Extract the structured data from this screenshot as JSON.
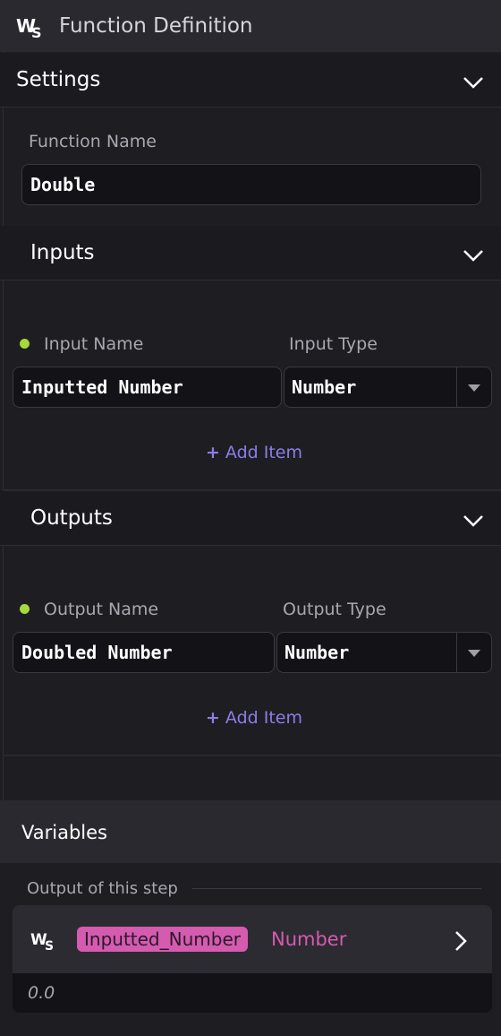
{
  "header": {
    "title": "Function Definition",
    "logo_icon": "ws-logo-icon"
  },
  "settings": {
    "title": "Settings",
    "function_name_label": "Function Name",
    "function_name_value": "Double"
  },
  "inputs": {
    "title": "Inputs",
    "name_label": "Input Name",
    "type_label": "Input Type",
    "name_value": "Inputted Number",
    "type_value": "Number",
    "add_item": "Add Item"
  },
  "outputs": {
    "title": "Outputs",
    "name_label": "Output Name",
    "type_label": "Output Type",
    "name_value": "Doubled Number",
    "type_value": "Number",
    "add_item": "Add Item"
  },
  "variables": {
    "title": "Variables",
    "output_label": "Output of this step",
    "var_name": "Inputted_Number",
    "var_type": "Number",
    "var_value": "0.0"
  },
  "colors": {
    "accent_purple": "#8b7ee8",
    "pill_pink": "#d45bb0",
    "status_green": "#a6d93a"
  }
}
